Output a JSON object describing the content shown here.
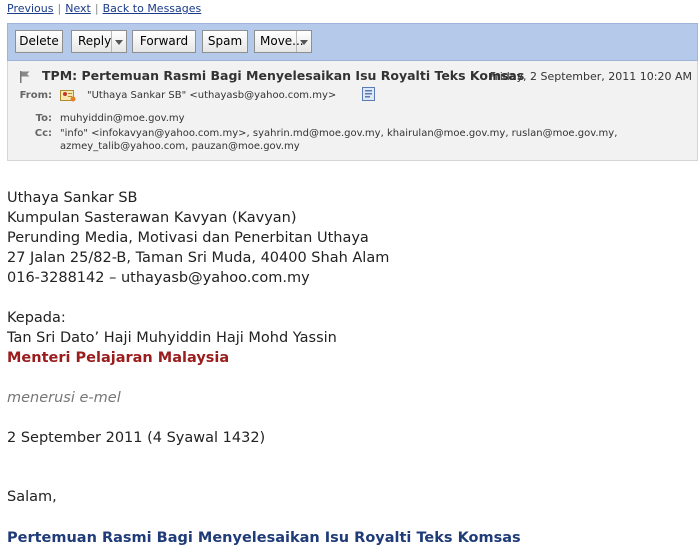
{
  "nav": {
    "previous": "Previous",
    "next": "Next",
    "back": "Back to Messages",
    "separator": "|"
  },
  "toolbar": {
    "delete": "Delete",
    "reply": "Reply",
    "forward": "Forward",
    "spam": "Spam",
    "move": "Move..."
  },
  "header": {
    "subject": "TPM: Pertemuan Rasmi Bagi Menyelesaikan Isu Royalti Teks Komsas",
    "date": "Friday, 2 September, 2011 10:20 AM",
    "from_label": "From:",
    "from_value": "\"Uthaya Sankar SB\" <uthayasb@yahoo.com.my>",
    "to_label": "To:",
    "to_value": "muhyiddin@moe.gov.my",
    "cc_label": "Cc:",
    "cc_line1": "\"info\" <infokavyan@yahoo.com.my>, syahrin.md@moe.gov.my, khairulan@moe.gov.my, ruslan@moe.gov.my,",
    "cc_line2": "azmey_talib@yahoo.com, pauzan@moe.gov.my"
  },
  "body": {
    "sender_name": "Uthaya Sankar SB",
    "sender_org": "Kumpulan Sasterawan Kavyan (Kavyan)",
    "sender_org2": "Perunding Media, Motivasi dan Penerbitan Uthaya",
    "sender_address": "27 Jalan 25/82-B, Taman Sri Muda, 40400 Shah Alam",
    "sender_contact": "016-3288142 – uthayasb@yahoo.com.my",
    "to_heading": "Kepada:",
    "recipient_name": "Tan Sri Dato’ Haji Muhyiddin Haji Mohd Yassin",
    "recipient_title": "Menteri Pelajaran Malaysia",
    "via": "menerusi e-mel",
    "letter_date": "2 September 2011 (4 Syawal 1432)",
    "greeting": "Salam,",
    "letter_subject": "Pertemuan Rasmi Bagi Menyelesaikan Isu Royalti Teks Komsas"
  },
  "colors": {
    "toolbar_bg": "#b5c9ea",
    "header_bg": "#f2f2f2",
    "link": "#1a3a8a",
    "recipient_title": "#9b1c1c",
    "letter_subject": "#1f3b78"
  }
}
